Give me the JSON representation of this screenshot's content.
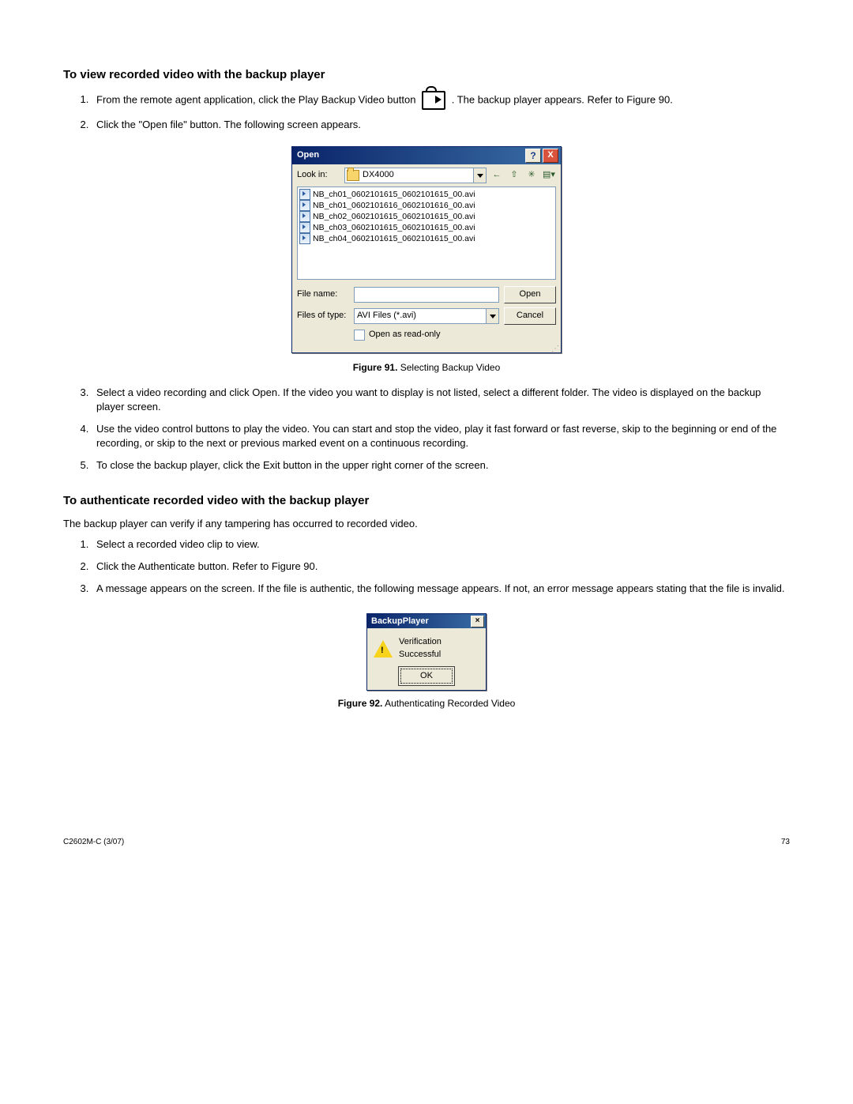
{
  "heading1": "To view recorded video with the backup player",
  "steps1": [
    {
      "pre": "From the remote agent application, click the Play Backup Video button",
      "post": ". The backup player appears. Refer to Figure 90."
    },
    {
      "pre": "Click the \"Open file\" button. The following screen appears."
    }
  ],
  "open_dialog": {
    "title": "Open",
    "look_in_label": "Look in:",
    "folder": "DX4000",
    "files": [
      "NB_ch01_0602101615_0602101615_00.avi",
      "NB_ch01_0602101616_0602101616_00.avi",
      "NB_ch02_0602101615_0602101615_00.avi",
      "NB_ch03_0602101615_0602101615_00.avi",
      "NB_ch04_0602101615_0602101615_00.avi"
    ],
    "filename_label": "File name:",
    "filename_value": "",
    "type_label": "Files of type:",
    "type_value": "AVI Files (*.avi)",
    "open_btn": "Open",
    "cancel_btn": "Cancel",
    "readonly_label": "Open as read-only"
  },
  "fig91_bold": "Figure 91.",
  "fig91_text": "  Selecting Backup Video",
  "steps1b": [
    "Select a video recording and click Open. If the video you want to display is not listed, select a different folder. The video is displayed on the backup player screen.",
    "Use the video control buttons to play the video. You can start and stop the video, play it fast forward or fast reverse, skip to the beginning or end of the recording, or skip to the next or previous marked event on a continuous recording.",
    "To close the backup player, click the Exit button in the upper right corner of the screen."
  ],
  "heading2": "To authenticate recorded video with the backup player",
  "intro2": "The backup player can verify if any tampering has occurred to recorded video.",
  "steps2": [
    "Select a recorded video clip to view.",
    "Click the Authenticate button. Refer to Figure 90.",
    "A message appears on the screen. If the file is authentic, the following message appears. If not, an error message appears stating that the file is invalid."
  ],
  "msgbox": {
    "title": "BackupPlayer",
    "body": "Verification Successful",
    "ok": "OK"
  },
  "fig92_bold": "Figure 92.",
  "fig92_text": "  Authenticating Recorded Video",
  "footer_left": "C2602M-C (3/07)",
  "footer_right": "73"
}
